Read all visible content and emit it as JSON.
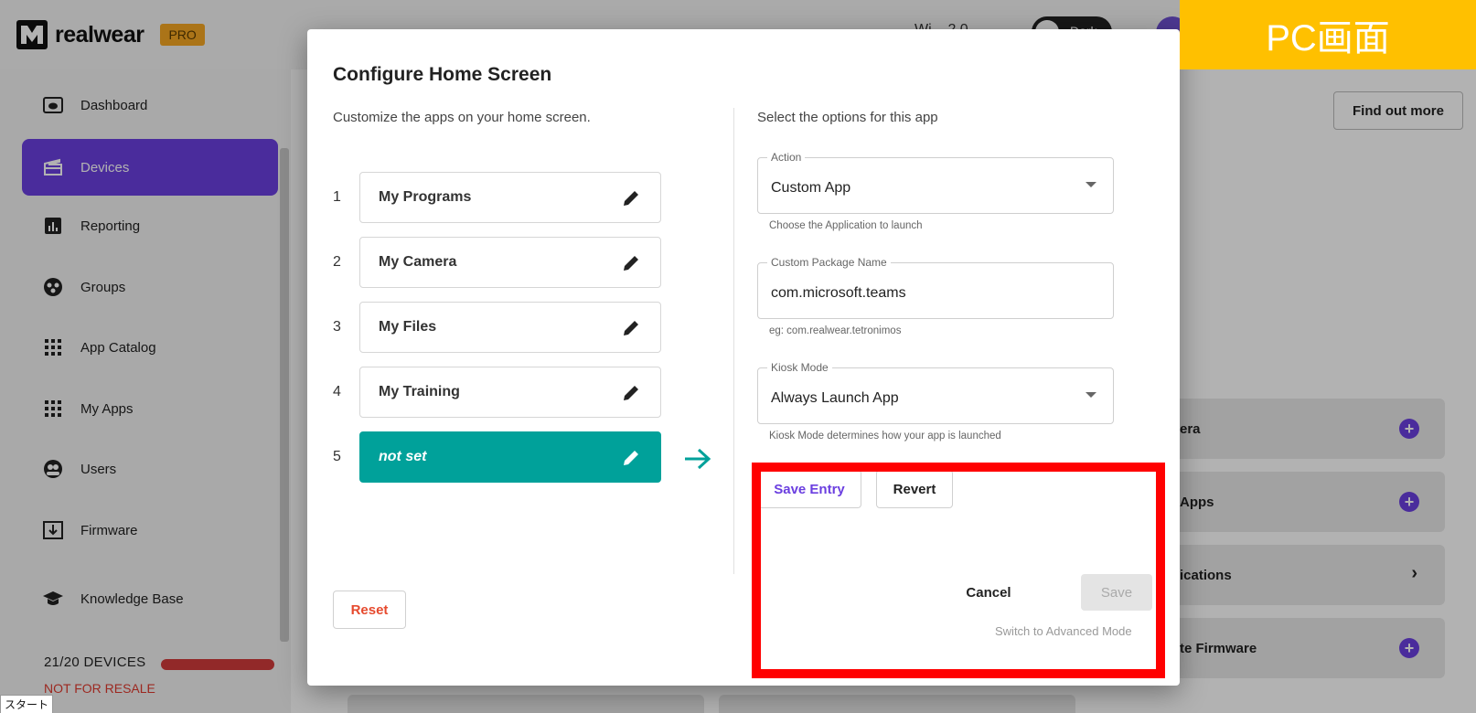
{
  "header": {
    "brand": "realwear",
    "badge": "PRO",
    "right_text": "Wi... 2.0",
    "toggle_label": "Dark"
  },
  "sidebar": {
    "items": [
      {
        "label": "Dashboard",
        "icon": "dashboard-icon"
      },
      {
        "label": "Devices",
        "icon": "device-icon"
      },
      {
        "label": "Reporting",
        "icon": "reporting-icon"
      },
      {
        "label": "Groups",
        "icon": "groups-icon"
      },
      {
        "label": "App Catalog",
        "icon": "grid-icon"
      },
      {
        "label": "My Apps",
        "icon": "grid-icon"
      },
      {
        "label": "Users",
        "icon": "users-icon"
      },
      {
        "label": "Firmware",
        "icon": "firmware-icon"
      },
      {
        "label": "Knowledge Base",
        "icon": "graduation-cap-icon"
      }
    ],
    "active": "Devices",
    "devices_count": "21/20 DEVICES",
    "resale": "NOT FOR RESALE"
  },
  "taskbar": {
    "start": "スタート"
  },
  "main": {
    "find_more": "Find out more",
    "cards": [
      {
        "label": "era"
      },
      {
        "label": "Apps"
      },
      {
        "label": "ications"
      },
      {
        "label": "te Firmware"
      }
    ]
  },
  "dialog": {
    "title": "Configure Home Screen",
    "subtitle": "Customize the apps on your home screen.",
    "slots": [
      {
        "num": "1",
        "label": "My Programs"
      },
      {
        "num": "2",
        "label": "My Camera"
      },
      {
        "num": "3",
        "label": "My Files"
      },
      {
        "num": "4",
        "label": "My Training"
      },
      {
        "num": "5",
        "label": "not set"
      }
    ],
    "reset": "Reset",
    "options_heading": "Select the options for this app",
    "action": {
      "label": "Action",
      "value": "Custom App",
      "hint": "Choose the Application to launch"
    },
    "package": {
      "label": "Custom Package Name",
      "value": "com.microsoft.teams",
      "hint": "eg: com.realwear.tetronimos"
    },
    "kiosk": {
      "label": "Kiosk Mode",
      "value": "Always Launch App",
      "hint": "Kiosk Mode determines how your app is launched"
    },
    "save_entry": "Save Entry",
    "revert": "Revert",
    "cancel": "Cancel",
    "save": "Save",
    "advanced": "Switch to Advanced Mode"
  },
  "overlay": {
    "pc_label": "PC画面",
    "highlight_color": "#ff0000"
  },
  "colors": {
    "accent": "#6b3fe0",
    "teal": "#00a19a",
    "reset": "#e64a2e",
    "label_bg": "#ffc000"
  }
}
